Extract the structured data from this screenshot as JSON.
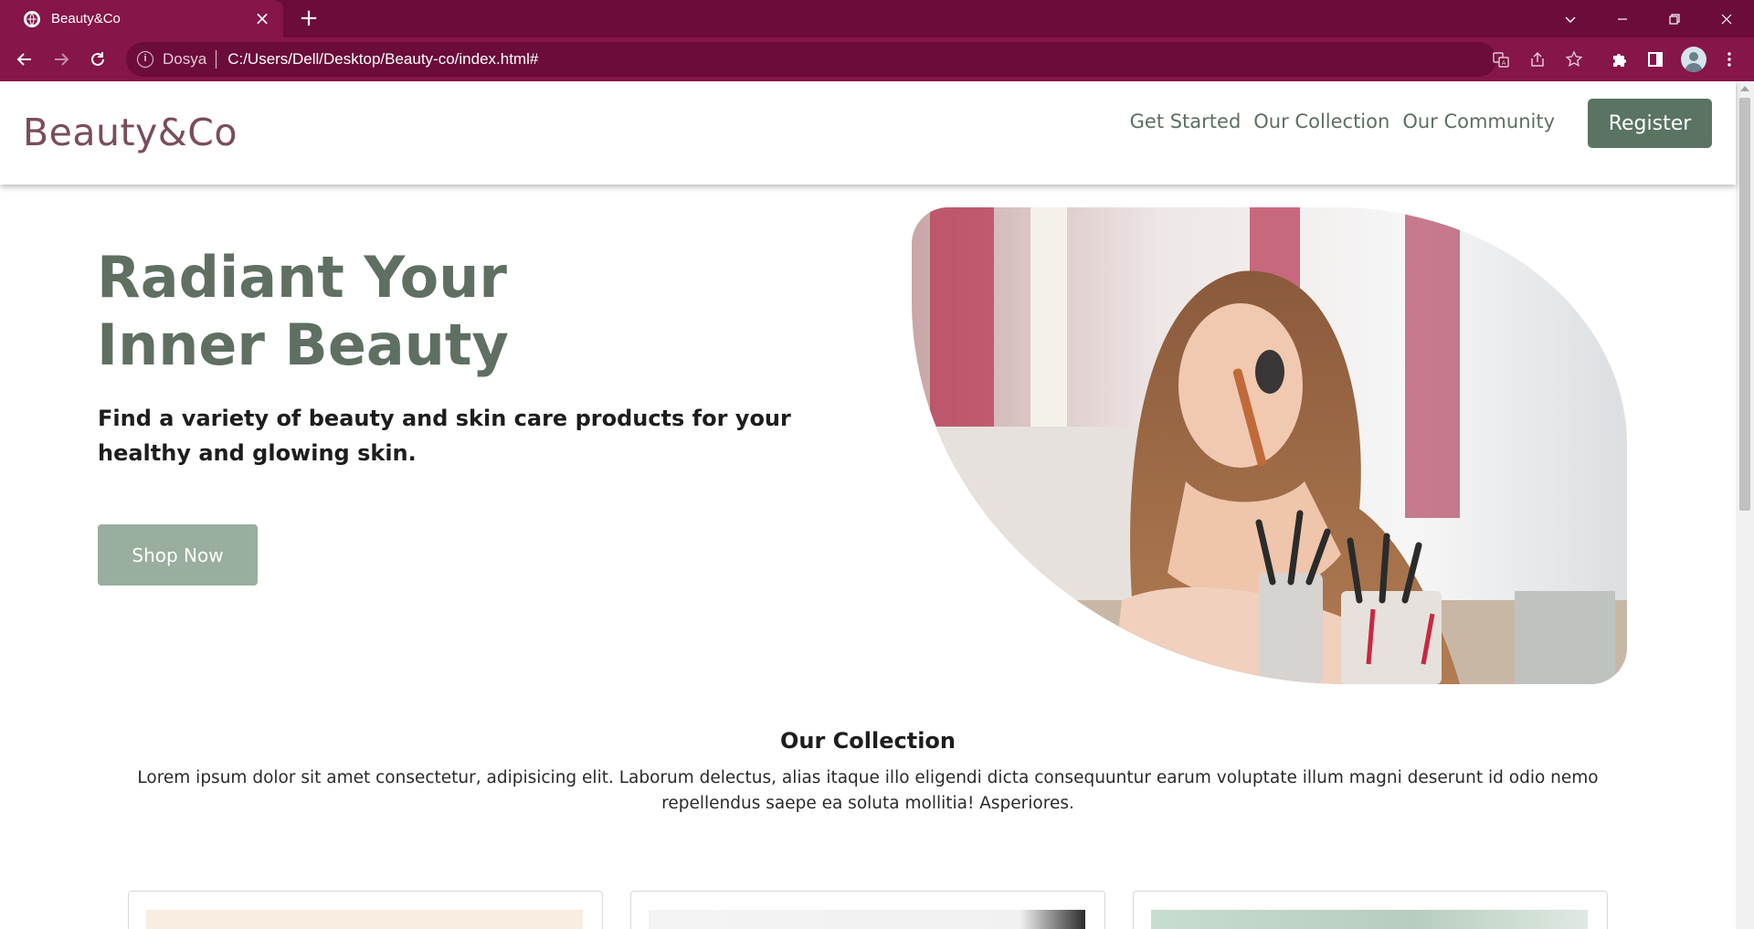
{
  "browser": {
    "tab_title": "Beauty&Co",
    "site_label": "Dosya",
    "url": "C:/Users/Dell/Desktop/Beauty-co/index.html#"
  },
  "nav": {
    "brand": "Beauty&Co",
    "links": [
      "Get Started",
      "Our Collection",
      "Our Community"
    ],
    "register_label": "Register"
  },
  "hero": {
    "title_line1": "Radiant Your",
    "title_line2": "Inner Beauty",
    "subtitle": "Find a variety of beauty and skin care products for your healthy and glowing skin.",
    "cta_label": "Shop Now"
  },
  "collection": {
    "title": "Our Collection",
    "description": "Lorem ipsum dolor sit amet consectetur, adipisicing elit. Laborum delectus, alias itaque illo eligendi dicta consequuntur earum voluptate illum magni deserunt id odio nemo repellendus saepe ea soluta mollitia! Asperiores."
  },
  "colors": {
    "chrome_dark": "#6b0c3a",
    "chrome_tab": "#861549",
    "brand": "#7a4c5c",
    "accent_green": "#5a7363",
    "button_sage": "#9aae9f",
    "heading_green": "#5f6f62"
  },
  "icons": {
    "tab_favicon": "globe-icon",
    "back": "arrow-left-icon",
    "forward": "arrow-right-icon",
    "reload": "reload-icon",
    "info": "info-icon",
    "translate": "translate-icon",
    "share": "share-icon",
    "bookmark": "star-icon",
    "extensions": "puzzle-icon",
    "side_panel": "side-panel-icon",
    "menu": "kebab-menu-icon"
  }
}
